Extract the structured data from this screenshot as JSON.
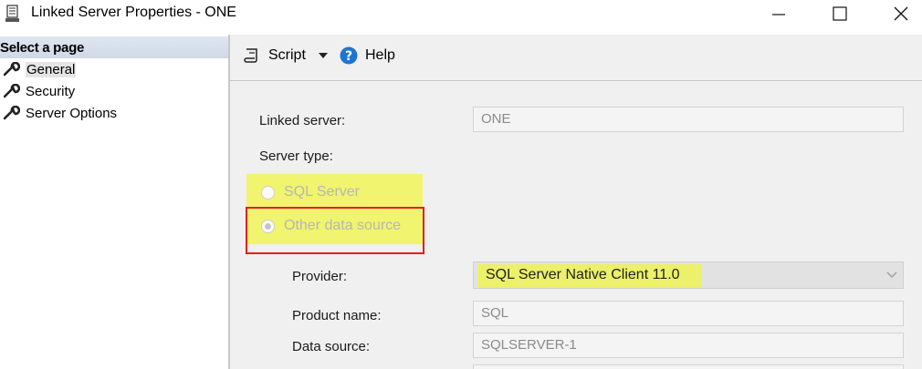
{
  "window": {
    "title": "Linked Server Properties - ONE",
    "icon": "server-icon",
    "controls": [
      "minimize-icon",
      "maximize-icon",
      "close-icon"
    ]
  },
  "left_pane": {
    "header": "Select a page",
    "items": [
      {
        "label": "General",
        "icon": "wrench-icon",
        "selected": true
      },
      {
        "label": "Security",
        "icon": "wrench-icon",
        "selected": false
      },
      {
        "label": "Server Options",
        "icon": "wrench-icon",
        "selected": false
      }
    ]
  },
  "toolbar": {
    "script_label": "Script",
    "help_label": "Help"
  },
  "form": {
    "linked_server_label": "Linked server:",
    "linked_server_value": "ONE",
    "server_type_label": "Server type:",
    "radio_sql_server": "SQL Server",
    "radio_other": "Other data source",
    "selected_server_type": "Other data source",
    "provider_label": "Provider:",
    "provider_value": "SQL Server Native Client 11.0",
    "product_name_label": "Product name:",
    "product_name_value": "SQL",
    "data_source_label": "Data source:",
    "data_source_value": "SQLSERVER-1"
  },
  "annotations": {
    "highlight_color": "#f0f53c",
    "box_color": "#e02020"
  }
}
